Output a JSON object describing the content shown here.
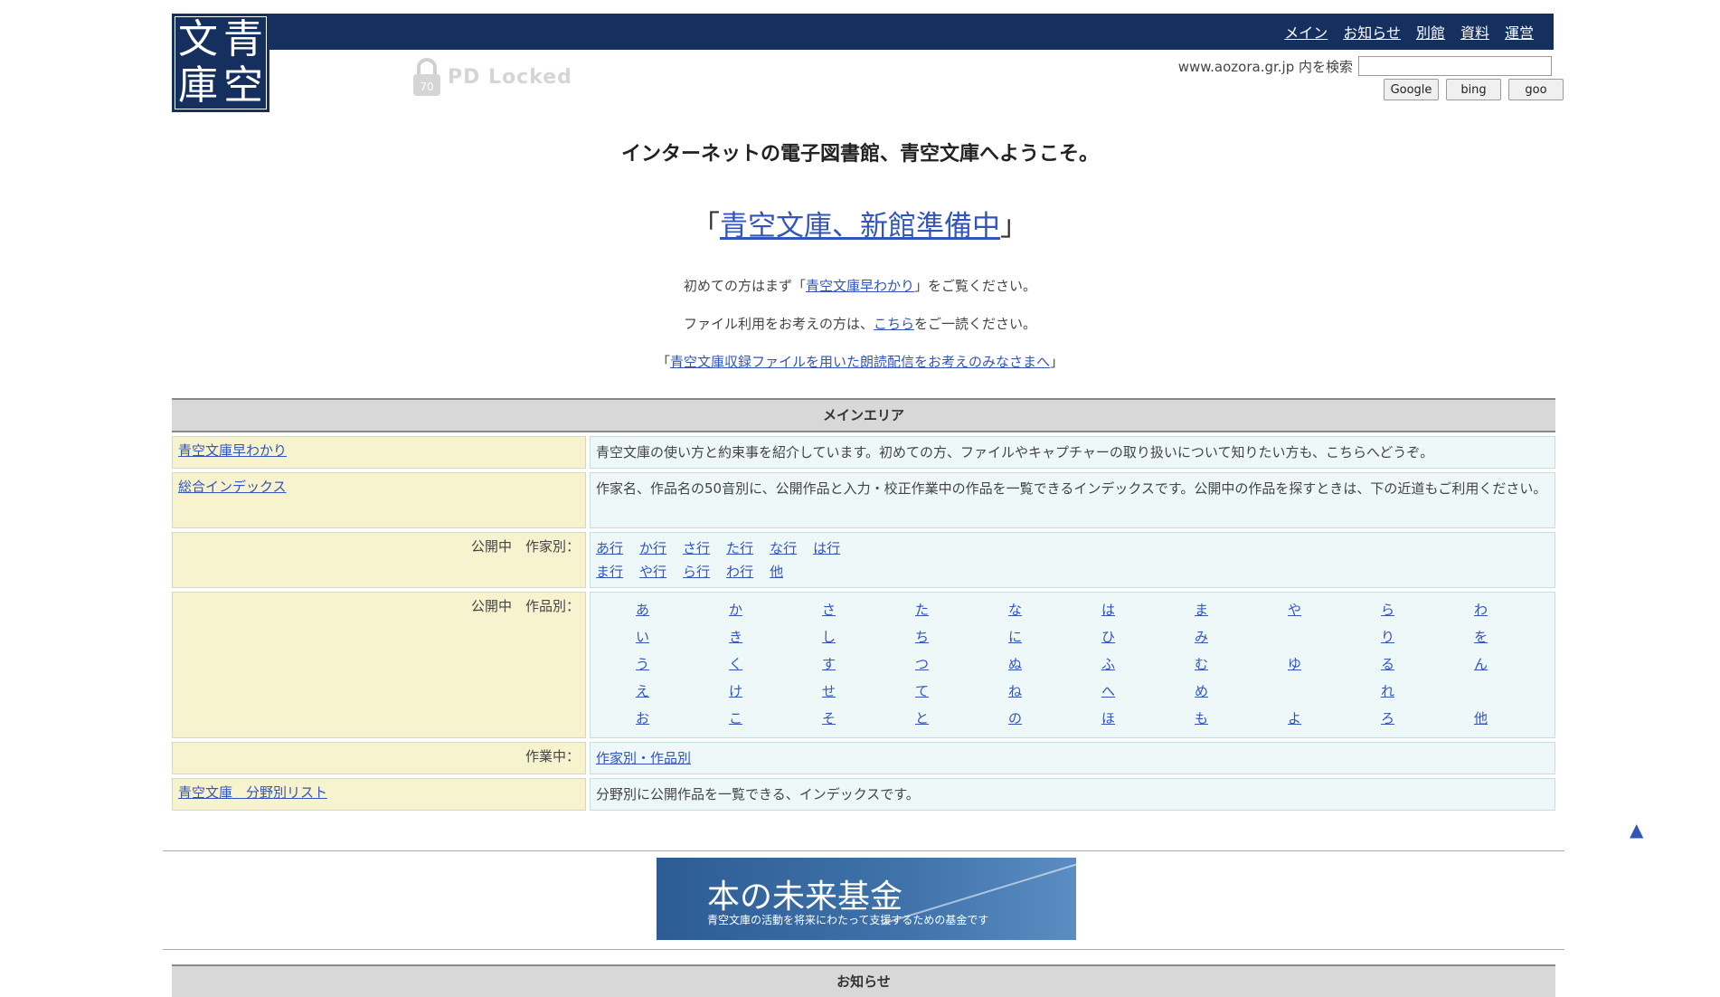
{
  "logo": {
    "chars": [
      "文",
      "青",
      "庫",
      "空"
    ]
  },
  "nav": {
    "items": [
      {
        "label": "メイン"
      },
      {
        "label": "お知らせ"
      },
      {
        "label": "別館"
      },
      {
        "label": "資料"
      },
      {
        "label": "運営"
      }
    ]
  },
  "locked_watermark": "PD Locked",
  "search": {
    "label": "www.aozora.gr.jp 内を検索",
    "value": "",
    "buttons": [
      "Google",
      "bing",
      "goo"
    ]
  },
  "intro": {
    "welcome": "インターネットの電子図書館、青空文庫へようこそ。",
    "shinkan_open": "「",
    "shinkan_link": "青空文庫、新館準備中",
    "shinkan_close": "」",
    "line1_pre": "初めての方はまず「",
    "line1_link": "青空文庫早わかり",
    "line1_post": "」をご覧ください。",
    "line2_pre": "ファイル利用をお考えの方は、",
    "line2_link": "こちら",
    "line2_post": "をご一読ください。",
    "line3_open": "「",
    "line3_link": "青空文庫収録ファイルを用いた朗読配信をお考えのみなさまへ",
    "line3_close": "」"
  },
  "main_area": {
    "heading": "メインエリア",
    "hayawakari": {
      "link": "青空文庫早わかり",
      "desc": "青空文庫の使い方と約束事を紹介しています。初めての方、ファイルやキャプチャーの取り扱いについて知りたい方も、こちらへどうぞ。"
    },
    "index": {
      "link": "総合インデックス",
      "desc": "作家名、作品名の50音別に、公開作品と入力・校正作業中の作品を一覧できるインデックスです。公開中の作品を探すときは、下の近道もご利用ください。"
    },
    "by_author": {
      "label": "公開中　作家別：",
      "gyo": [
        "あ行",
        "か行",
        "さ行",
        "た行",
        "な行",
        "は行",
        "ま行",
        "や行",
        "ら行",
        "わ行",
        "他"
      ]
    },
    "by_work": {
      "label": "公開中　作品別：",
      "rows": [
        [
          "あ",
          "か",
          "さ",
          "た",
          "な",
          "は",
          "ま",
          "や",
          "ら",
          "わ"
        ],
        [
          "い",
          "き",
          "し",
          "ち",
          "に",
          "ひ",
          "み",
          "",
          "り",
          "を"
        ],
        [
          "う",
          "く",
          "す",
          "つ",
          "ぬ",
          "ふ",
          "む",
          "ゆ",
          "る",
          "ん"
        ],
        [
          "え",
          "け",
          "せ",
          "て",
          "ね",
          "へ",
          "め",
          "",
          "れ",
          ""
        ],
        [
          "お",
          "こ",
          "そ",
          "と",
          "の",
          "ほ",
          "も",
          "よ",
          "ろ",
          "他"
        ]
      ]
    },
    "in_progress": {
      "label": "作業中：",
      "link": "作家別・作品別"
    },
    "genre": {
      "link": "青空文庫　分野別リスト",
      "desc": "分野別に公開作品を一覧できる、インデックスです。"
    }
  },
  "banner": {
    "title": "本の未来基金",
    "subtitle": "青空文庫の活動を将来にわたって支援するための基金です"
  },
  "news_heading": "お知らせ",
  "totop": "▲"
}
